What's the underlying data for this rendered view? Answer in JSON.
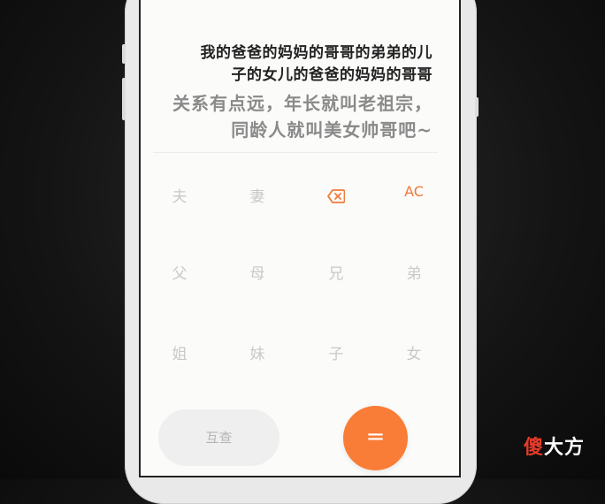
{
  "display": {
    "expression_line1": "我的爸爸的妈妈的哥哥的弟弟的儿",
    "expression_line2": "子的女儿的爸爸的妈妈的哥哥",
    "result_line1": "关系有点远，年长就叫老祖宗，",
    "result_line2": "同龄人就叫美女帅哥吧~"
  },
  "keypad": {
    "row1": [
      "夫",
      "妻"
    ],
    "clear_label": "AC",
    "backspace_icon": "backspace-icon",
    "row2": [
      "父",
      "母",
      "兄",
      "弟"
    ],
    "row3": [
      "姐",
      "妹",
      "子",
      "女"
    ]
  },
  "actions": {
    "lookup_label": "互查",
    "equals_label": "="
  },
  "watermark": {
    "first_char": "傻",
    "rest": "大方"
  },
  "colors": {
    "accent": "#f97d37",
    "key_text": "#c9c9c9",
    "result_text": "#8a8a8a"
  }
}
